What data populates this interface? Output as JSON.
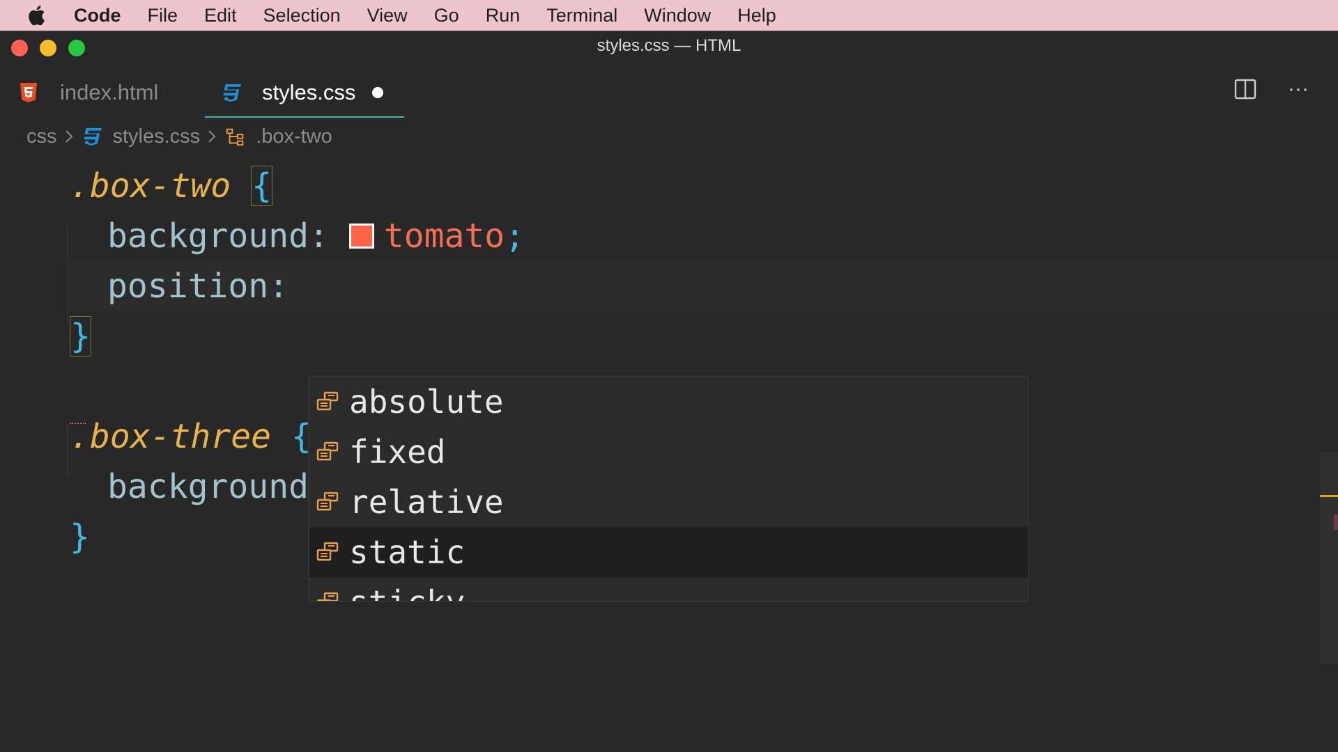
{
  "menubar": {
    "app": "Code",
    "items": [
      "File",
      "Edit",
      "Selection",
      "View",
      "Go",
      "Run",
      "Terminal",
      "Window",
      "Help"
    ]
  },
  "window": {
    "title": "styles.css — HTML"
  },
  "tabs": [
    {
      "label": "index.html",
      "icon": "html5-icon",
      "active": false
    },
    {
      "label": "styles.css",
      "icon": "css3-icon",
      "active": true,
      "dirty": true
    }
  ],
  "tab_actions": {
    "split": "split-editor-icon",
    "more": "···"
  },
  "breadcrumb": {
    "folder": "css",
    "file": "styles.css",
    "symbol": ".box-two"
  },
  "code": {
    "rule1_selector": ".box-two",
    "open_brace": "{",
    "close_brace": "}",
    "line2_prop": "background:",
    "line2_value": "tomato",
    "line2_semicolon": ";",
    "line3_prop": "position:",
    "rule2_selector": ".box-three",
    "line6_prop": "background"
  },
  "swatch_color": "#ff6347",
  "suggestions": [
    {
      "label": "absolute",
      "selected": false
    },
    {
      "label": "fixed",
      "selected": false
    },
    {
      "label": "relative",
      "selected": false
    },
    {
      "label": "static",
      "selected": true
    },
    {
      "label": "sticky",
      "selected": false
    }
  ]
}
